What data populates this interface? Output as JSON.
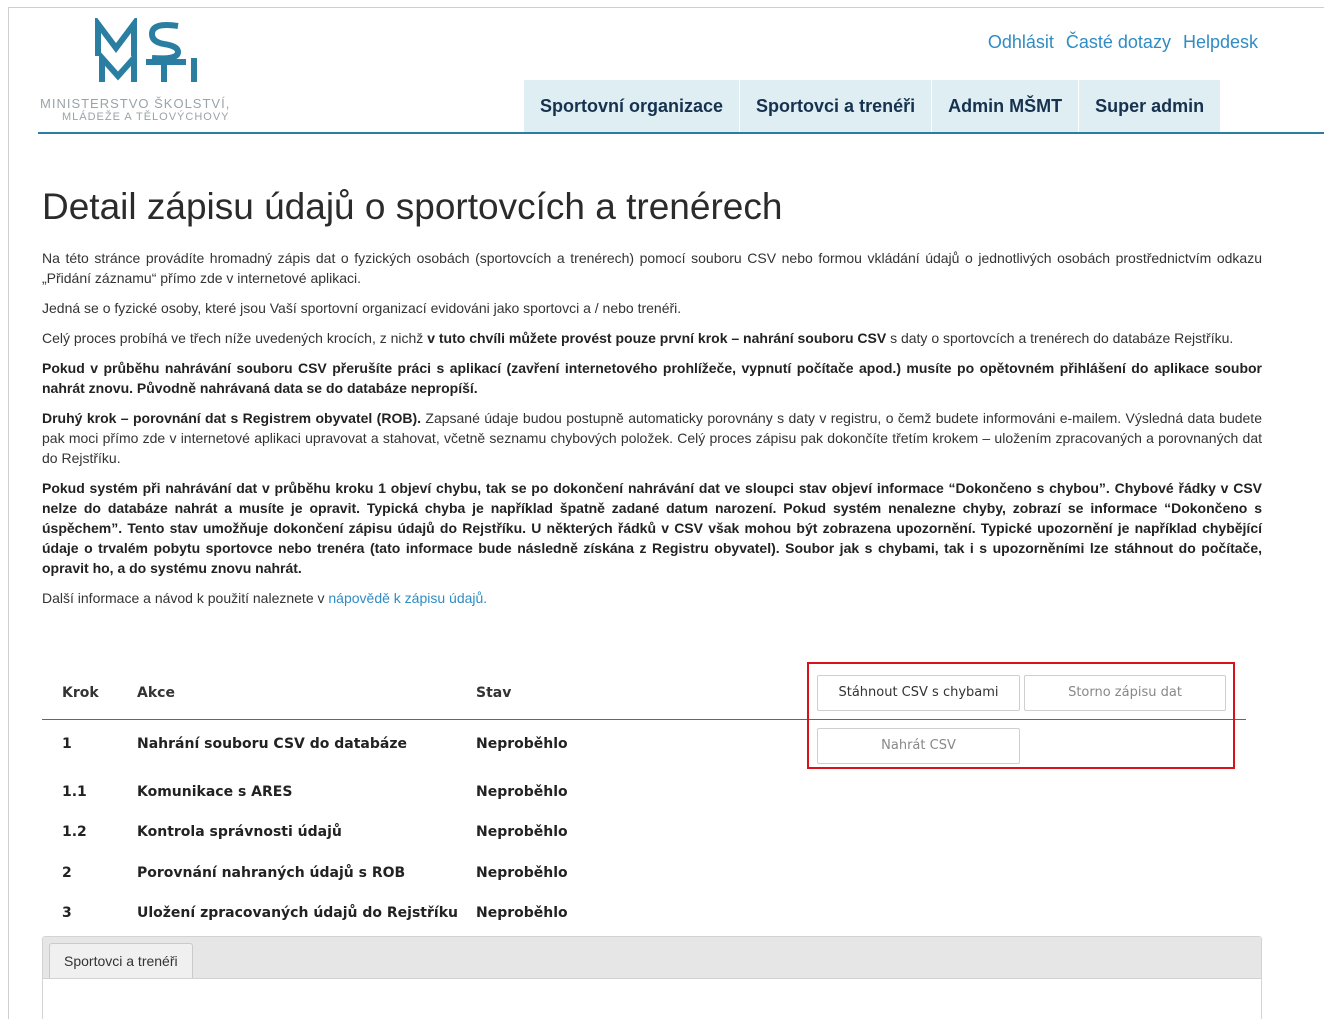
{
  "header": {
    "logo_line1": "MINISTERSTVO ŠKOLSTVÍ,",
    "logo_line2": "MLÁDEŽE A TĚLOVÝCHOVY",
    "links": [
      "Odhlásit",
      "Časté dotazy",
      "Helpdesk"
    ],
    "nav": [
      "Sportovní organizace",
      "Sportovci a trenéři",
      "Admin MŠMT",
      "Super admin"
    ]
  },
  "page": {
    "title": "Detail zápisu údajů o sportovcích a trenérech",
    "p1": "Na této stránce provádíte hromadný zápis dat o fyzických osobách (sportovcích a trenérech) pomocí souboru CSV nebo formou vkládání údajů o jednotlivých osobách prostřednictvím odkazu „Přidání záznamu“ přímo zde v internetové aplikaci.",
    "p2": "Jedná se o fyzické osoby, které jsou Vaší sportovní organizací evidováni jako sportovci a / nebo trenéři.",
    "p3_a": "Celý proces probíhá ve třech níže uvedených krocích, z nichž ",
    "p3_b": "v tuto chvíli můžete provést pouze první krok – nahrání souboru CSV",
    "p3_c": " s daty o sportovcích a trenérech do databáze Rejstříku.",
    "p4": "Pokud v průběhu nahrávání souboru CSV přerušíte práci s aplikací (zavření internetového prohlížeče, vypnutí počítače apod.) musíte po opětovném přihlášení do aplikace soubor nahrát znovu. Původně nahrávaná data se do databáze nepropíší.",
    "p5_a": "Druhý krok – porovnání dat s Registrem obyvatel (ROB).",
    "p5_b": " Zapsané údaje budou postupně automaticky porovnány s daty v registru, o čemž budete informováni e-mailem. Výsledná data budete pak moci přímo zde v internetové aplikaci upravovat a stahovat, včetně seznamu chybových položek. Celý proces zápisu pak dokončíte třetím krokem – uložením zpracovaných a porovnaných dat do Rejstříku.",
    "p6": "Pokud systém při nahrávání dat v průběhu kroku 1 objeví chybu, tak se po dokončení nahrávání dat ve sloupci stav objeví informace “Dokončeno s chybou”. Chybové řádky v CSV nelze do databáze nahrát a musíte je opravit. Typická chyba je například špatně zadané datum narození. Pokud systém nenalezne chyby, zobrazí se informace “Dokončeno s úspěchem”. Tento stav umožňuje dokončení zápisu údajů do Rejstříku. U některých řádků v CSV však mohou být zobrazena upozornění. Typické upozornění je například chybějící údaje o trvalém pobytu sportovce nebo trenéra (tato informace bude následně získána z Registru obyvatel). Soubor jak s chybami, tak i s upozorněními lze stáhnout do počítače, opravit ho, a do systému znovu nahrát.",
    "p7_a": "Další informace a návod k použití naleznete v ",
    "p7_link": "nápovědě k zápisu údajů."
  },
  "table": {
    "headers": {
      "krok": "Krok",
      "akce": "Akce",
      "stav": "Stav"
    },
    "rows": [
      {
        "krok": "1",
        "akce": "Nahrání souboru CSV do databáze",
        "stav": "Neproběhlo"
      },
      {
        "krok": "1.1",
        "akce": "Komunikace s ARES",
        "stav": "Neproběhlo"
      },
      {
        "krok": "1.2",
        "akce": "Kontrola správnosti údajů",
        "stav": "Neproběhlo"
      },
      {
        "krok": "2",
        "akce": "Porovnání nahraných údajů s ROB",
        "stav": "Neproběhlo"
      },
      {
        "krok": "3",
        "akce": "Uložení zpracovaných údajů do Rejstříku",
        "stav": "Neproběhlo"
      }
    ]
  },
  "buttons": {
    "download_errors": "Stáhnout CSV s chybami",
    "cancel": "Storno zápisu dat",
    "upload": "Nahrát CSV"
  },
  "tabs": [
    "Sportovci a trenéři"
  ]
}
